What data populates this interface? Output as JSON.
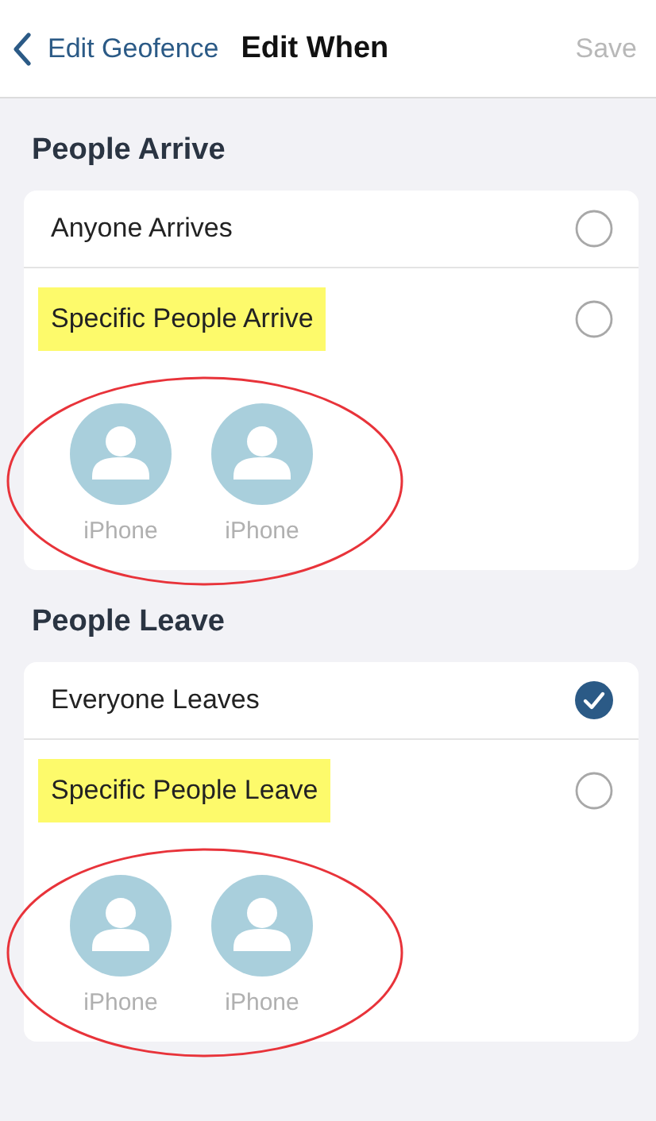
{
  "header": {
    "back_label": "Edit Geofence",
    "title": "Edit When",
    "save_label": "Save",
    "save_disabled": true
  },
  "sections": [
    {
      "title": "People Arrive",
      "options": [
        {
          "label": "Anyone Arrives",
          "selected": false,
          "highlighted": false
        },
        {
          "label": "Specific People Arrive",
          "selected": false,
          "highlighted": true
        }
      ],
      "people": [
        {
          "name": "iPhone"
        },
        {
          "name": "iPhone"
        }
      ],
      "circled": true
    },
    {
      "title": "People Leave",
      "options": [
        {
          "label": "Everyone Leaves",
          "selected": true,
          "highlighted": false
        },
        {
          "label": "Specific People Leave",
          "selected": false,
          "highlighted": true
        }
      ],
      "people": [
        {
          "name": "iPhone"
        },
        {
          "name": "iPhone"
        }
      ],
      "circled": true
    }
  ]
}
